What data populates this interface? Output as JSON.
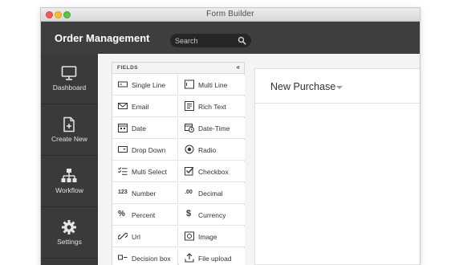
{
  "window": {
    "title": "Form Builder"
  },
  "header": {
    "app_title": "Order Management",
    "search_placeholder": "Search"
  },
  "sidebar": {
    "items": [
      {
        "label": "Dashboard",
        "icon": "monitor-icon"
      },
      {
        "label": "Create New",
        "icon": "new-document-icon"
      },
      {
        "label": "Workflow",
        "icon": "workflow-icon"
      },
      {
        "label": "Settings",
        "icon": "gear-icon"
      }
    ]
  },
  "fields": {
    "title": "FIELDS",
    "collapse_label": "«",
    "items": [
      {
        "label": "Single Line",
        "icon": "single-line-icon"
      },
      {
        "label": "Multi Line",
        "icon": "multi-line-icon"
      },
      {
        "label": "Email",
        "icon": "email-icon"
      },
      {
        "label": "Rich Text",
        "icon": "rich-text-icon"
      },
      {
        "label": "Date",
        "icon": "calendar-icon"
      },
      {
        "label": "Date-Time",
        "icon": "date-time-icon"
      },
      {
        "label": "Drop Down",
        "icon": "dropdown-icon"
      },
      {
        "label": "Radio",
        "icon": "radio-icon"
      },
      {
        "label": "Multi Select",
        "icon": "multi-select-icon"
      },
      {
        "label": "Checkbox",
        "icon": "checkbox-icon"
      },
      {
        "label": "Number",
        "icon": "number-icon",
        "glyph": "123"
      },
      {
        "label": "Decimal",
        "icon": "decimal-icon",
        "glyph": ".00"
      },
      {
        "label": "Percent",
        "icon": "percent-icon",
        "glyph": "%"
      },
      {
        "label": "Currency",
        "icon": "currency-icon",
        "glyph": "$"
      },
      {
        "label": "Url",
        "icon": "link-icon"
      },
      {
        "label": "Image",
        "icon": "image-icon"
      },
      {
        "label": "Decision box",
        "icon": "decision-box-icon"
      },
      {
        "label": "File upload",
        "icon": "file-upload-icon"
      }
    ]
  },
  "form": {
    "title": "New Purchase"
  }
}
